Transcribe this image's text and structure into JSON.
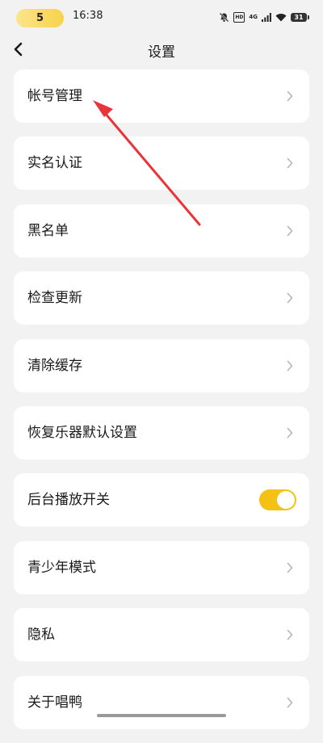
{
  "status_bar": {
    "pill_text": "5",
    "time": "16:38",
    "hd_badge": "HD",
    "network": "4G",
    "battery": "31"
  },
  "header": {
    "title": "设置"
  },
  "settings": {
    "items": [
      {
        "label": "帐号管理"
      },
      {
        "label": "实名认证"
      },
      {
        "label": "黑名单"
      },
      {
        "label": "检查更新"
      },
      {
        "label": "清除缓存"
      },
      {
        "label": "恢复乐器默认设置"
      },
      {
        "label": "后台播放开关",
        "toggle_on": true
      },
      {
        "label": "青少年模式"
      },
      {
        "label": "隐私"
      },
      {
        "label": "关于唱鸭"
      }
    ]
  },
  "colors": {
    "accent": "#f5c115",
    "background": "#f2f2f2",
    "card": "#ffffff",
    "annotation_arrow": "#e8343a"
  }
}
